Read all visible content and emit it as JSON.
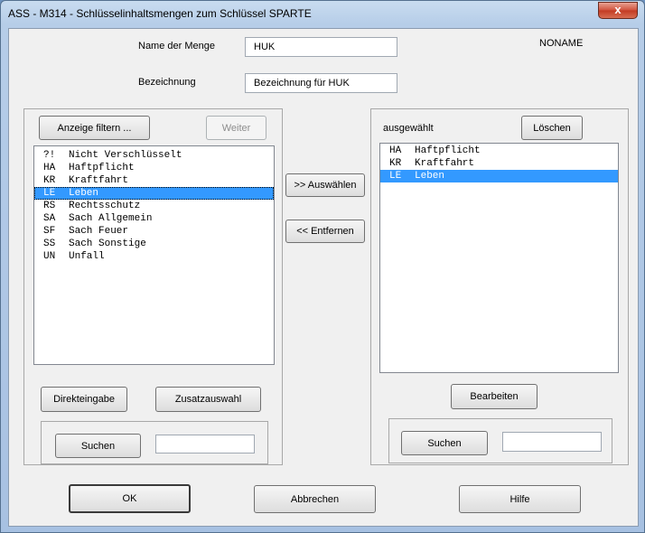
{
  "window": {
    "title": "ASS - M314 - Schlüsselinhaltsmengen zum Schlüssel SPARTE",
    "close_label": "x"
  },
  "header": {
    "name_label": "Name der Menge",
    "name_value": "HUK",
    "desc_label": "Bezeichnung",
    "desc_value": "Bezeichnung für HUK",
    "noname": "NONAME"
  },
  "left": {
    "filter_button": "Anzeige filtern ...",
    "next_button": "Weiter",
    "items": [
      {
        "code": "?!",
        "text": "Nicht Verschlüsselt"
      },
      {
        "code": "HA",
        "text": "Haftpflicht"
      },
      {
        "code": "KR",
        "text": "Kraftfahrt"
      },
      {
        "code": "LE",
        "text": "Leben"
      },
      {
        "code": "RS",
        "text": "Rechtsschutz"
      },
      {
        "code": "SA",
        "text": "Sach Allgemein"
      },
      {
        "code": "SF",
        "text": "Sach Feuer"
      },
      {
        "code": "SS",
        "text": "Sach Sonstige"
      },
      {
        "code": "UN",
        "text": "Unfall"
      }
    ],
    "selected_index": 3,
    "direct_button": "Direkteingabe",
    "extra_button": "Zusatzauswahl",
    "search_button": "Suchen",
    "search_value": ""
  },
  "middle": {
    "select_button": ">> Auswählen",
    "remove_button": "<< Entfernen"
  },
  "right": {
    "selected_label": "ausgewählt",
    "clear_button": "Löschen",
    "items": [
      {
        "code": "HA",
        "text": "Haftpflicht"
      },
      {
        "code": "KR",
        "text": "Kraftfahrt"
      },
      {
        "code": "LE",
        "text": "Leben"
      }
    ],
    "selected_index": 2,
    "edit_button": "Bearbeiten",
    "search_button": "Suchen",
    "search_value": ""
  },
  "footer": {
    "ok_button": "OK",
    "cancel_button": "Abbrechen",
    "help_button": "Hilfe"
  },
  "colors": {
    "selection": "#3399ff",
    "close_button": "#c23a22"
  }
}
